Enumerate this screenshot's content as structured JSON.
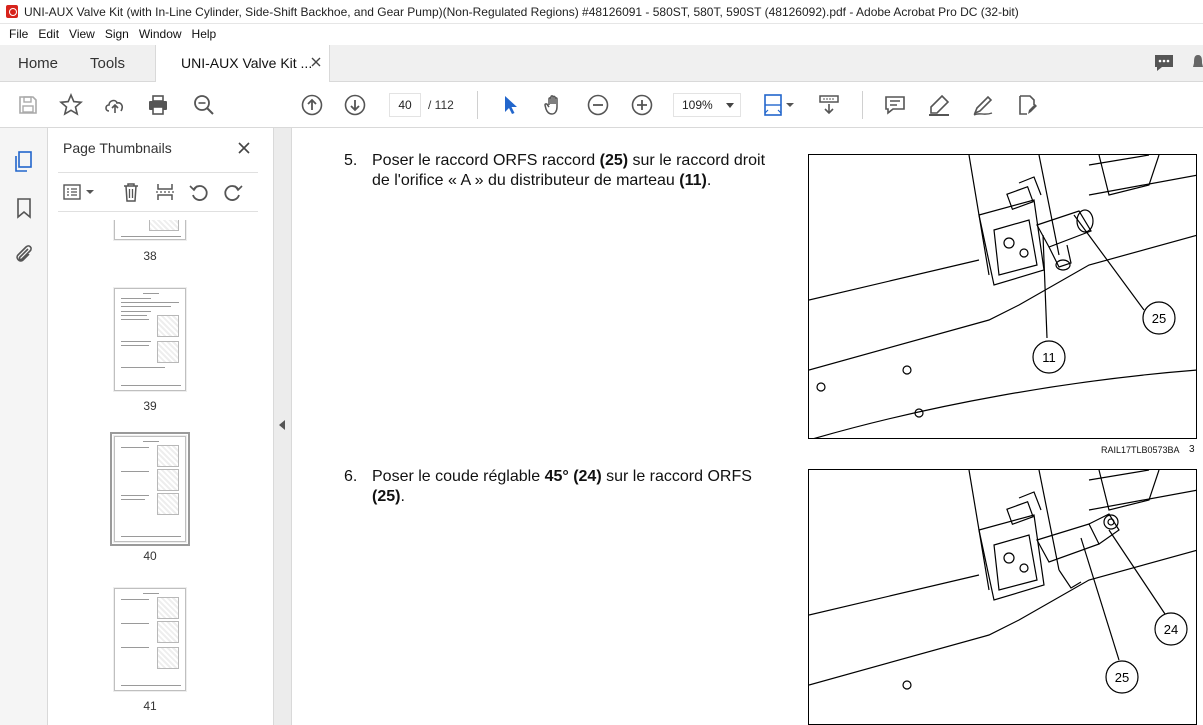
{
  "window": {
    "title": "UNI-AUX Valve Kit (with In-Line Cylinder, Side-Shift Backhoe, and Gear Pump)(Non-Regulated Regions) #48126091 - 580ST, 580T, 590ST (48126092).pdf - Adobe Acrobat Pro DC (32-bit)"
  },
  "menu": [
    "File",
    "Edit",
    "View",
    "Sign",
    "Window",
    "Help"
  ],
  "tabs": {
    "home": "Home",
    "tools": "Tools",
    "document": "UNI-AUX Valve Kit ..."
  },
  "toolbar": {
    "current_page": "40",
    "total_pages": "/ 112",
    "zoom": "109%"
  },
  "icons": {
    "save": "save-icon",
    "star": "star-icon",
    "upload": "cloud-upload-icon",
    "print": "print-icon",
    "find": "zoom-search-icon",
    "prev": "page-up-icon",
    "next": "page-down-icon",
    "select": "cursor-icon",
    "hand": "hand-icon",
    "zoom_out": "zoom-out-icon",
    "zoom_in": "zoom-in-icon",
    "fit": "fit-page-icon",
    "scroll": "scroll-mode-icon",
    "comment": "comment-icon",
    "highlight": "highlight-icon",
    "draw": "draw-icon",
    "fill_sign": "fill-sign-icon"
  },
  "thumbnail_panel": {
    "title": "Page Thumbnails",
    "pages": [
      "38",
      "39",
      "40",
      "41"
    ],
    "selected": "40"
  },
  "document": {
    "step5": {
      "number": "5.",
      "text_parts": [
        "Poser le raccord ORFS raccord ",
        "(25)",
        " sur le raccord droit de l'orifice « A » du distributeur de marteau ",
        "(11)",
        "."
      ]
    },
    "step6": {
      "number": "6.",
      "text_parts": [
        "Poser le coude réglable ",
        "45° (24)",
        " sur le raccord ORFS ",
        "(25)",
        "."
      ]
    },
    "figure1": {
      "callouts": [
        "25",
        "11"
      ],
      "caption": "RAIL17TLB0573BA",
      "figure_number": "3"
    },
    "figure2": {
      "callouts": [
        "24",
        "25"
      ]
    }
  }
}
